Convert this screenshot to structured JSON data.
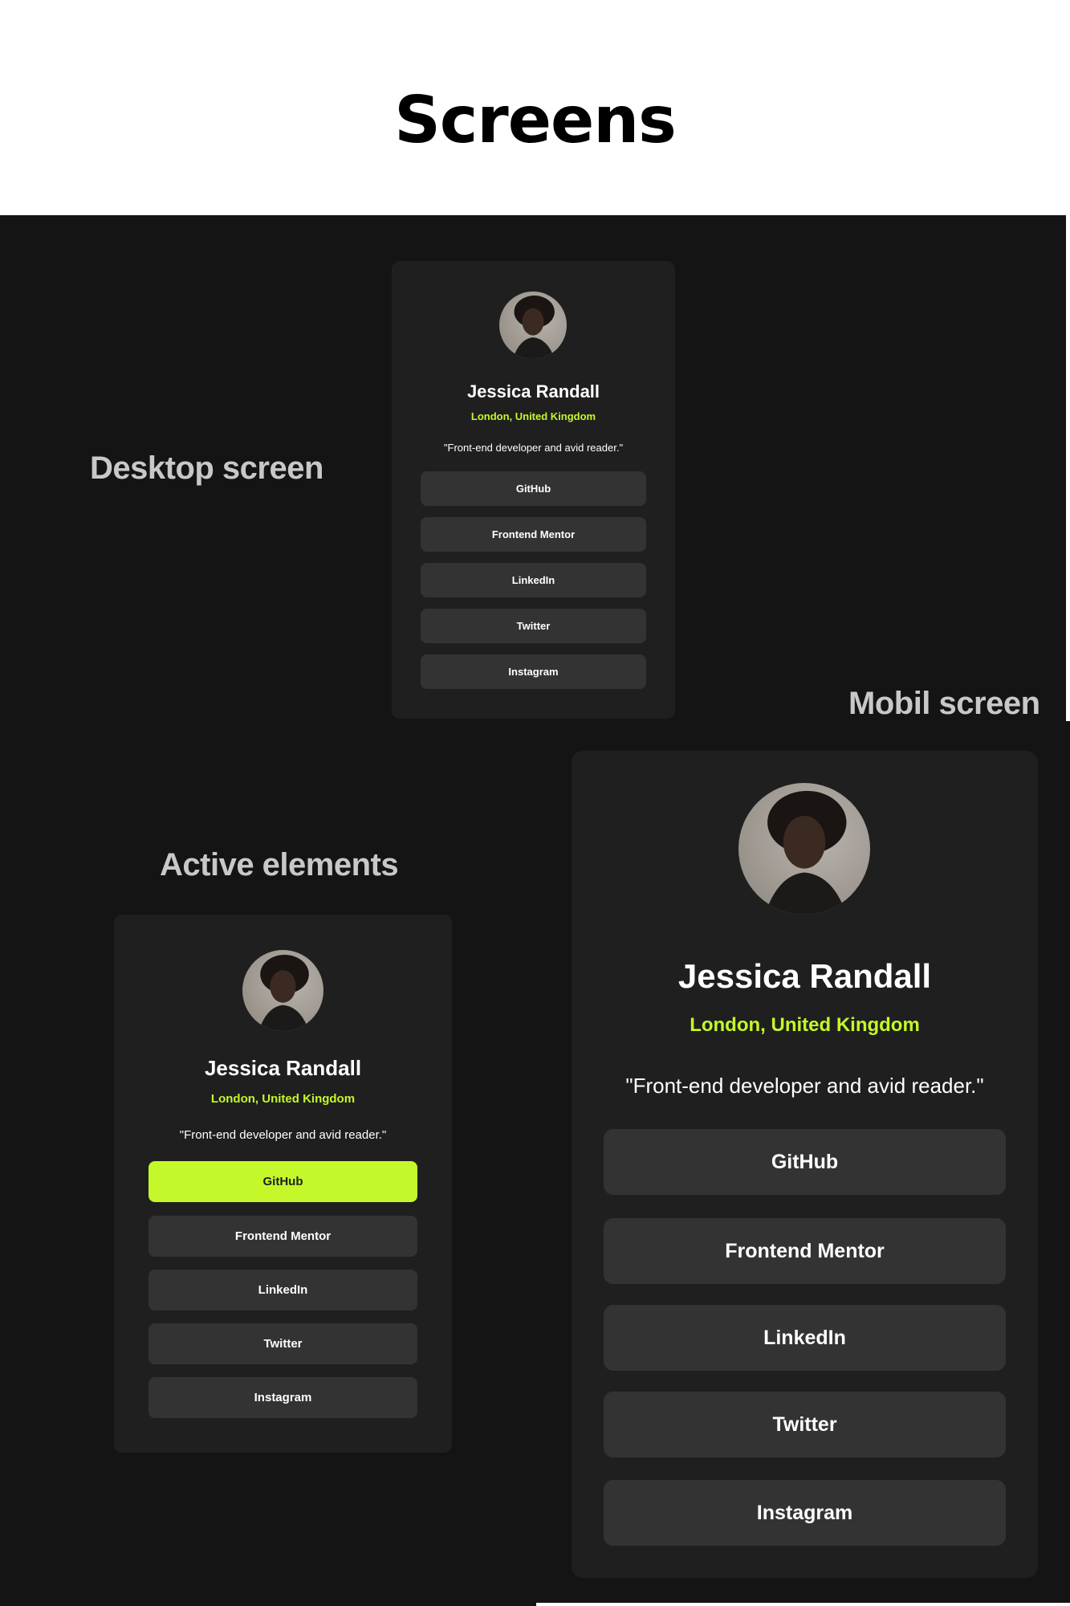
{
  "page": {
    "title": "Screens"
  },
  "labels": {
    "desktop": "Desktop screen",
    "mobile": "Mobil screen",
    "active": "Active elements"
  },
  "profile": {
    "name": "Jessica Randall",
    "location": "London, United Kingdom",
    "bio": "\"Front-end developer and avid reader.\"",
    "avatar_icon": "profile-photo"
  },
  "links": [
    "GitHub",
    "Frontend Mentor",
    "LinkedIn",
    "Twitter",
    "Instagram"
  ],
  "colors": {
    "background_dark": "#141414",
    "card": "#1f1f1f",
    "button": "#333333",
    "accent": "#c4f82a",
    "text": "#ffffff"
  },
  "active_state": {
    "highlighted_link": "GitHub"
  }
}
